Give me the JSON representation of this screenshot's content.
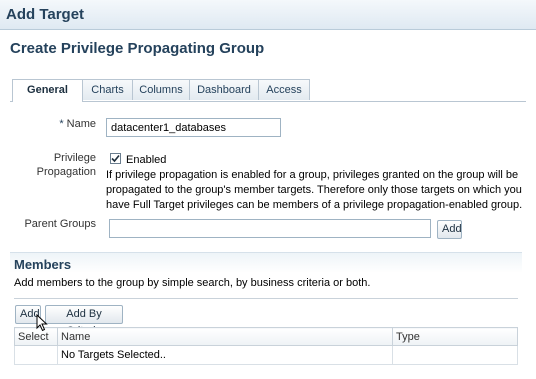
{
  "header": {
    "title": "Add Target"
  },
  "page": {
    "title": "Create Privilege Propagating Group"
  },
  "tabs": [
    {
      "label": "General",
      "active": true
    },
    {
      "label": "Charts",
      "active": false
    },
    {
      "label": "Columns",
      "active": false
    },
    {
      "label": "Dashboard",
      "active": false
    },
    {
      "label": "Access",
      "active": false
    }
  ],
  "form": {
    "name_required_mark": "*",
    "name_label": "Name",
    "name_value": "datacenter1_databases",
    "privilege_label_line1": "Privilege",
    "privilege_label_line2": "Propagation",
    "enabled_label": "Enabled",
    "enabled_checked": true,
    "privilege_help": "If privilege propagation is enabled for a group, privileges granted on the group will be propagated to the group's member targets. Therefore only those targets on which you have Full Target privileges can be members of a privilege propagation-enabled group.",
    "parent_groups_label": "Parent Groups",
    "parent_groups_value": "",
    "parent_add_button": "Add"
  },
  "members": {
    "title": "Members",
    "description": "Add members to the group by simple search, by business criteria or both.",
    "add_button": "Add",
    "add_by_criteria_button": "Add By Criteria",
    "columns": [
      "Select",
      "Name",
      "Type"
    ],
    "empty_text": "No Targets Selected.."
  },
  "colors": {
    "heading": "#25425c",
    "border": "#9fb3c3"
  }
}
